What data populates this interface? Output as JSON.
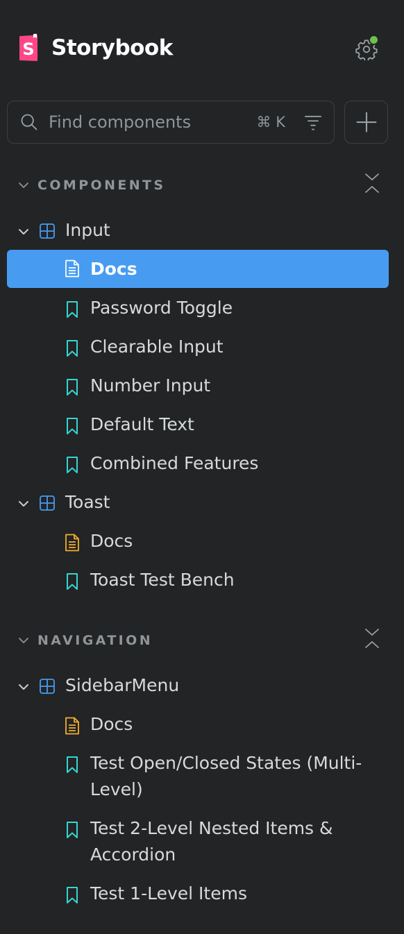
{
  "brand": {
    "name": "Storybook",
    "accent": "#ff4785"
  },
  "status_color": "#6ac34c",
  "search": {
    "placeholder": "Find components",
    "value": "",
    "shortcut": "⌘ K"
  },
  "colors": {
    "background": "#222425",
    "selected": "#479cf2",
    "component_icon": "#479cf2",
    "docs_icon": "#f5ae2d",
    "story_icon": "#37d5d3"
  },
  "sections": [
    {
      "title": "COMPONENTS",
      "components": [
        {
          "name": "Input",
          "icon": "component-icon",
          "expanded": true,
          "items": [
            {
              "label": "Docs",
              "type": "docs",
              "selected": true
            },
            {
              "label": "Password Toggle",
              "type": "story"
            },
            {
              "label": "Clearable Input",
              "type": "story"
            },
            {
              "label": "Number Input",
              "type": "story"
            },
            {
              "label": "Default Text",
              "type": "story"
            },
            {
              "label": "Combined Features",
              "type": "story"
            }
          ]
        },
        {
          "name": "Toast",
          "icon": "component-icon",
          "expanded": true,
          "items": [
            {
              "label": "Docs",
              "type": "docs"
            },
            {
              "label": "Toast Test Bench",
              "type": "story"
            }
          ]
        }
      ]
    },
    {
      "title": "NAVIGATION",
      "components": [
        {
          "name": "SidebarMenu",
          "icon": "component-icon",
          "expanded": true,
          "items": [
            {
              "label": "Docs",
              "type": "docs"
            },
            {
              "label": "Test Open/Closed States (Multi-Level)",
              "type": "story"
            },
            {
              "label": "Test 2-Level Nested Items & Accordion",
              "type": "story"
            },
            {
              "label": "Test 1-Level Items",
              "type": "story"
            }
          ]
        }
      ]
    }
  ]
}
